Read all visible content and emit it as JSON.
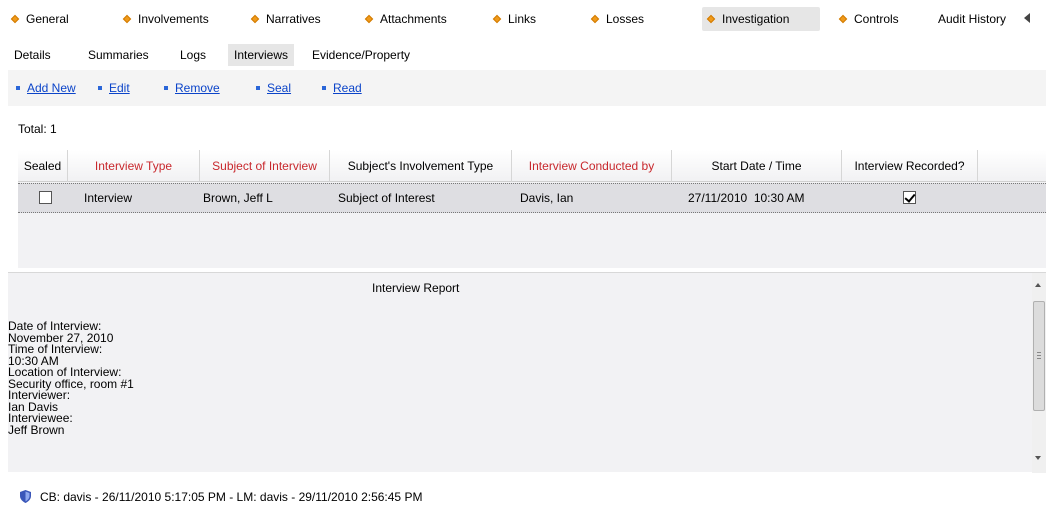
{
  "top_tabs": [
    {
      "label": "General",
      "icon": "diamond-icon"
    },
    {
      "label": "Involvements",
      "icon": "diamond-icon"
    },
    {
      "label": "Narratives",
      "icon": "diamond-icon"
    },
    {
      "label": "Attachments",
      "icon": "diamond-icon"
    },
    {
      "label": "Links",
      "icon": "diamond-icon"
    },
    {
      "label": "Losses",
      "icon": "diamond-icon"
    },
    {
      "label": "Investigation",
      "icon": "diamond-icon",
      "active": true
    },
    {
      "label": "Controls",
      "icon": "diamond-icon"
    },
    {
      "label": "Audit History"
    }
  ],
  "sub_tabs": [
    {
      "label": "Details"
    },
    {
      "label": "Summaries"
    },
    {
      "label": "Logs"
    },
    {
      "label": "Interviews",
      "active": true
    },
    {
      "label": "Evidence/Property"
    }
  ],
  "actions": [
    {
      "label": "Add New"
    },
    {
      "label": "Edit"
    },
    {
      "label": "Remove"
    },
    {
      "label": "Seal"
    },
    {
      "label": "Read"
    }
  ],
  "total": {
    "label": "Total: 1"
  },
  "grid": {
    "columns": [
      {
        "label": "Sealed"
      },
      {
        "label": "Interview Type",
        "required": true
      },
      {
        "label": "Subject of Interview",
        "required": true
      },
      {
        "label": "Subject's Involvement Type"
      },
      {
        "label": "Interview Conducted by",
        "required": true
      },
      {
        "label": "Start Date / Time"
      },
      {
        "label": "Interview Recorded?"
      }
    ],
    "rows": [
      {
        "sealed": false,
        "interview_type": "Interview",
        "subject": "Brown, Jeff L",
        "involvement_type": "Subject of Interest",
        "conducted_by": "Davis, Ian",
        "start": "27/11/2010  10:30 AM",
        "recorded": true
      }
    ]
  },
  "report": {
    "title": "Interview Report",
    "lines": [
      "Date of Interview:",
      "November 27, 2010",
      "Time of Interview:",
      "10:30 AM",
      "Location of Interview:",
      "Security office, room #1",
      "Interviewer:",
      "Ian Davis",
      "Interviewee:",
      "Jeff Brown"
    ]
  },
  "footer": {
    "icon": "shield-icon",
    "text": "CB: davis - 26/11/2010 5:17:05 PM - LM: davis - 29/11/2010 2:56:45 PM"
  },
  "colors": {
    "required_header": "#c8282d",
    "link": "#0b44c9",
    "diamond": "#f09a1a",
    "selected_row": "#dedee2"
  }
}
